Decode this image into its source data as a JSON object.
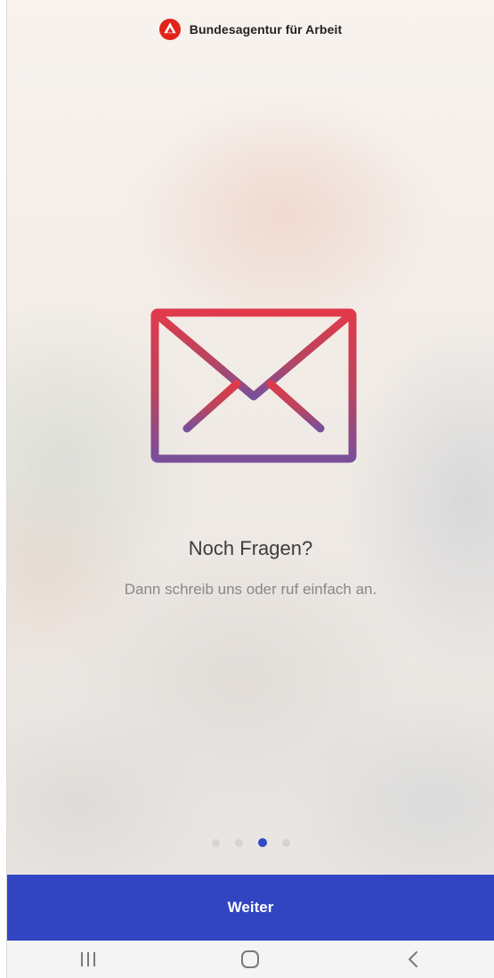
{
  "header": {
    "brand_name": "Bundesagentur für Arbeit",
    "logo_icon": "ba-logo-icon",
    "brand_color": "#e2231a"
  },
  "illustration": {
    "icon": "envelope-icon",
    "gradient_top": "#e03a4a",
    "gradient_bottom": "#7a4f9a"
  },
  "content": {
    "title": "Noch Fragen?",
    "subtitle": "Dann schreib uns oder ruf einfach an."
  },
  "pager": {
    "page_count": 4,
    "active_index": 2,
    "active_color": "#2f4bc4"
  },
  "primary_action": {
    "label": "Weiter",
    "color": "#3145c2"
  },
  "system_nav": {
    "recents_icon": "recents-icon",
    "home_icon": "home-icon",
    "back_icon": "back-icon"
  }
}
